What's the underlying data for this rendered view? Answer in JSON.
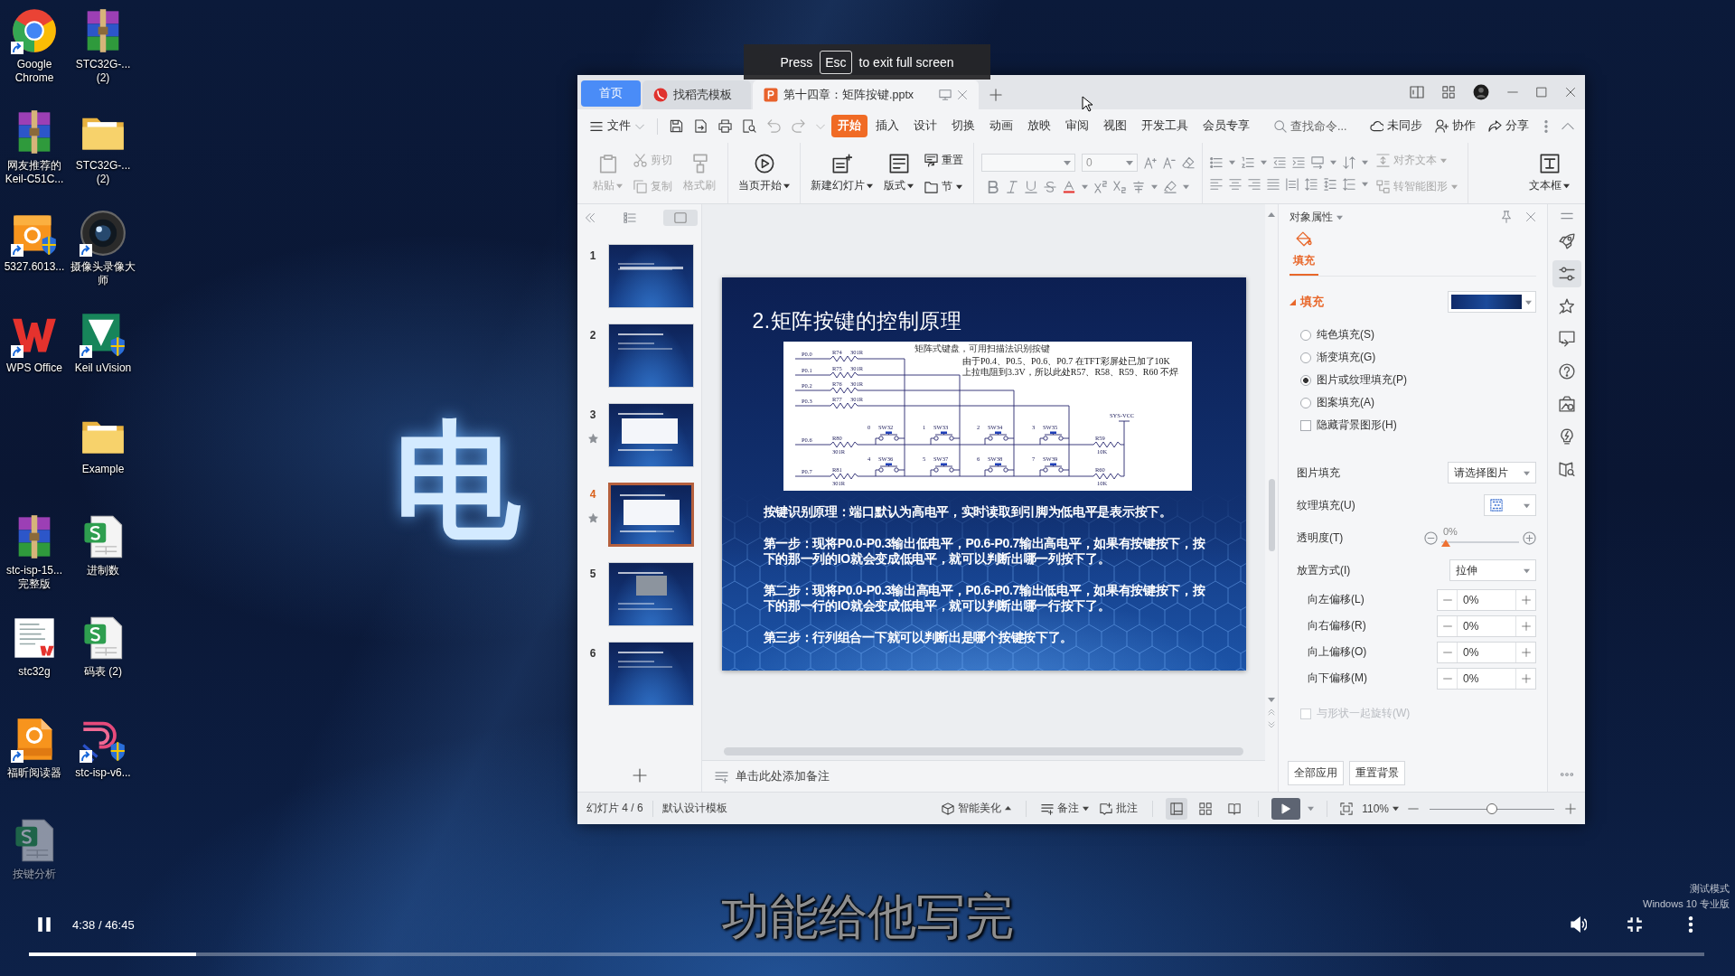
{
  "desktop": {
    "wallpaper_text": "电",
    "icons": [
      {
        "label": "Google Chrome",
        "kind": "browser",
        "shortcut": true,
        "dimmed": false
      },
      {
        "label": "网友推荐的Keil-C51C...",
        "kind": "archive",
        "shortcut": false,
        "dimmed": false
      },
      {
        "label": "5327.6013...",
        "kind": "pdf",
        "shortcut": true,
        "dimmed": false
      },
      {
        "label": "WPS Office",
        "kind": "office",
        "shortcut": true,
        "dimmed": false
      },
      {
        "label": "stc-isp-15... 完整版",
        "kind": "archive",
        "shortcut": false,
        "dimmed": false
      },
      {
        "label": "stc32g",
        "kind": "document",
        "shortcut": false,
        "dimmed": false
      },
      {
        "label": "福昕阅读器",
        "kind": "reader",
        "shortcut": true,
        "dimmed": false
      },
      {
        "label": "按键分析",
        "kind": "spreadsheet",
        "shortcut": false,
        "dimmed": true
      },
      {
        "label": "STC32G-... (2)",
        "kind": "archive",
        "shortcut": false,
        "dimmed": false
      },
      {
        "label": "STC32G-... (2)",
        "kind": "folder",
        "shortcut": false,
        "dimmed": false
      },
      {
        "label": "摄像头录像大师",
        "kind": "camera",
        "shortcut": true,
        "dimmed": false
      },
      {
        "label": "Keil uVision",
        "kind": "ide",
        "shortcut": true,
        "dimmed": false
      },
      {
        "label": "Example",
        "kind": "folder",
        "shortcut": false,
        "dimmed": false
      },
      {
        "label": "进制数",
        "kind": "spreadsheet",
        "shortcut": false,
        "dimmed": false
      },
      {
        "label": "码表 (2)",
        "kind": "spreadsheet",
        "shortcut": false,
        "dimmed": false
      },
      {
        "label": "stc-isp-v6...",
        "kind": "tool",
        "shortcut": true,
        "dimmed": false
      }
    ],
    "watermark": [
      "测试模式",
      "Windows 10 专业版"
    ]
  },
  "fullscreen_notice": {
    "before": "Press",
    "key": "Esc",
    "after": "to exit full screen"
  },
  "window": {
    "tabs": [
      {
        "label": "首页",
        "kind": "home",
        "selected": false
      },
      {
        "label": "找稻壳模板",
        "kind": "template",
        "selected": false
      },
      {
        "label": "第十四章：矩阵按键.pptx",
        "kind": "document",
        "selected": true
      }
    ],
    "menu": {
      "file": "文件",
      "items": [
        {
          "label": "开始",
          "selected": true
        },
        {
          "label": "插入",
          "selected": false
        },
        {
          "label": "设计",
          "selected": false
        },
        {
          "label": "切换",
          "selected": false
        },
        {
          "label": "动画",
          "selected": false
        },
        {
          "label": "放映",
          "selected": false
        },
        {
          "label": "审阅",
          "selected": false
        },
        {
          "label": "视图",
          "selected": false
        },
        {
          "label": "开发工具",
          "selected": false
        },
        {
          "label": "会员专享",
          "selected": false
        }
      ],
      "search_placeholder": "查找命令...",
      "actions": [
        "未同步",
        "协作",
        "分享"
      ]
    },
    "ribbon": [
      {
        "kind": "buttons",
        "items": [
          {
            "label": "粘贴",
            "kind": "large",
            "dropdown": true,
            "disabled": true
          },
          {
            "label": "剪切",
            "kind": "small",
            "dropdown": false,
            "disabled": true
          },
          {
            "label": "复制",
            "kind": "small",
            "dropdown": false,
            "disabled": true
          },
          {
            "label": "格式刷",
            "kind": "large",
            "dropdown": false,
            "disabled": true
          }
        ]
      },
      {
        "kind": "buttons",
        "items": [
          {
            "label": "当页开始",
            "kind": "large",
            "dropdown": true,
            "disabled": false
          }
        ]
      },
      {
        "kind": "buttons",
        "items": [
          {
            "label": "新建幻灯片",
            "kind": "large",
            "dropdown": true,
            "disabled": false
          },
          {
            "label": "版式",
            "kind": "large",
            "dropdown": true,
            "disabled": false
          },
          {
            "label": "重置",
            "kind": "small",
            "dropdown": false,
            "disabled": false
          },
          {
            "label": "节",
            "kind": "small",
            "dropdown": true,
            "disabled": false
          }
        ]
      },
      {
        "kind": "font",
        "size": "0"
      },
      {
        "kind": "paragraph",
        "items": [
          {
            "label": "对齐文本",
            "kind": "small",
            "dropdown": true,
            "disabled": true
          },
          {
            "label": "转智能图形",
            "kind": "small",
            "dropdown": true,
            "disabled": true
          }
        ]
      },
      {
        "kind": "buttons",
        "items": [
          {
            "label": "文本框",
            "kind": "large",
            "dropdown": true,
            "disabled": false
          }
        ]
      }
    ],
    "slides_panel": {
      "thumbnails": [
        {
          "number": "1",
          "selected": false,
          "animated": false
        },
        {
          "number": "2",
          "selected": false,
          "animated": false
        },
        {
          "number": "3",
          "selected": false,
          "animated": true
        },
        {
          "number": "4",
          "selected": true,
          "animated": true
        },
        {
          "number": "5",
          "selected": false,
          "animated": false
        },
        {
          "number": "6",
          "selected": false,
          "animated": false
        }
      ]
    },
    "slide": {
      "title": "2.矩阵按键的控制原理",
      "diagram": {
        "caption": "矩阵式键盘，可用扫描法识别按键",
        "note": [
          "由于P0.4、P0.5、P0.6、P0.7 在TFT彩屏处已加了10K",
          "上拉电阻到3.3V，所以此处R57、R58、R59、R60 不焊"
        ],
        "ports": [
          "P0.0",
          "P0.1",
          "P0.2",
          "P0.3",
          "P0.6",
          "P0.7"
        ],
        "resistors": [
          {
            "name": "R74",
            "value": "301R"
          },
          {
            "name": "R75",
            "value": "301R"
          },
          {
            "name": "R76",
            "value": "301R"
          },
          {
            "name": "R77",
            "value": "301R"
          },
          {
            "name": "R80",
            "value": "301R"
          },
          {
            "name": "R81",
            "value": "301R"
          }
        ],
        "pullups": [
          {
            "name": "R59",
            "value": "10K"
          },
          {
            "name": "R60",
            "value": "10K"
          }
        ],
        "supply": "SYS-VCC",
        "switches": [
          {
            "number": "0",
            "name": "SW32"
          },
          {
            "number": "1",
            "name": "SW33"
          },
          {
            "number": "2",
            "name": "SW34"
          },
          {
            "number": "3",
            "name": "SW35"
          },
          {
            "number": "4",
            "name": "SW36"
          },
          {
            "number": "5",
            "name": "SW37"
          },
          {
            "number": "6",
            "name": "SW38"
          },
          {
            "number": "7",
            "name": "SW39"
          }
        ]
      },
      "paragraphs": [
        "按键识别原理：端口默认为高电平，实时读取到引脚为低电平是表示按下。",
        "第一步：现将P0.0-P0.3输出低电平，P0.6-P0.7输出高电平，如果有按键按下，按下的那一列的IO就会变成低电平，就可以判断出哪一列按下了。",
        "第二步：现将P0.0-P0.3输出高电平，P0.6-P0.7输出低电平，如果有按键按下，按下的那一行的IO就会变成低电平，就可以判断出哪一行按下了。",
        "第三步：行列组合一下就可以判断出是哪个按键按下了。"
      ]
    },
    "notes": {
      "placeholder": "单击此处添加备注"
    },
    "properties": {
      "title": "对象属性",
      "tabs": [
        {
          "label": "填充",
          "selected": true
        }
      ],
      "section": "填充",
      "section_expanded": true,
      "fill_options": [
        {
          "label": "纯色填充(S)",
          "selected": false
        },
        {
          "label": "渐变填充(G)",
          "selected": false
        },
        {
          "label": "图片或纹理填充(P)",
          "selected": true
        },
        {
          "label": "图案填充(A)",
          "selected": false
        }
      ],
      "hide_background": {
        "label": "隐藏背景图形(H)",
        "checked": false
      },
      "picture_fill": {
        "label": "图片填充",
        "value": "请选择图片"
      },
      "texture_fill": {
        "label": "纹理填充(U)"
      },
      "transparency": {
        "label": "透明度(T)",
        "reading": "0%",
        "level": 0
      },
      "placement": {
        "label": "放置方式(I)",
        "value": "拉伸"
      },
      "offsets": [
        {
          "label": "向左偏移(L)",
          "value": "0%"
        },
        {
          "label": "向右偏移(R)",
          "value": "0%"
        },
        {
          "label": "向上偏移(O)",
          "value": "0%"
        },
        {
          "label": "向下偏移(M)",
          "value": "0%"
        }
      ],
      "rotate_with_shape": {
        "label": "与形状一起旋转(W)",
        "checked": false,
        "disabled": true
      },
      "buttons": [
        "全部应用",
        "重置背景"
      ]
    },
    "side_tools": [
      {
        "selected": false
      },
      {
        "selected": true
      },
      {
        "selected": false
      },
      {
        "selected": false
      },
      {
        "selected": false
      },
      {
        "selected": false
      },
      {
        "selected": false
      },
      {
        "selected": false
      }
    ],
    "status_bar": {
      "slide_info": "幻灯片 4 / 6",
      "template": "默认设计模板",
      "beautify": "智能美化",
      "notes": "备注",
      "comments": "批注",
      "views": [
        {
          "selected": true
        },
        {
          "selected": false
        },
        {
          "selected": false
        }
      ],
      "zoom": "110%",
      "zoom_slider": {
        "level": 0.5
      }
    }
  },
  "video": {
    "playing": true,
    "time": "4:38 / 46:45",
    "level": 0.1,
    "subtitle": "功能给他写完"
  }
}
